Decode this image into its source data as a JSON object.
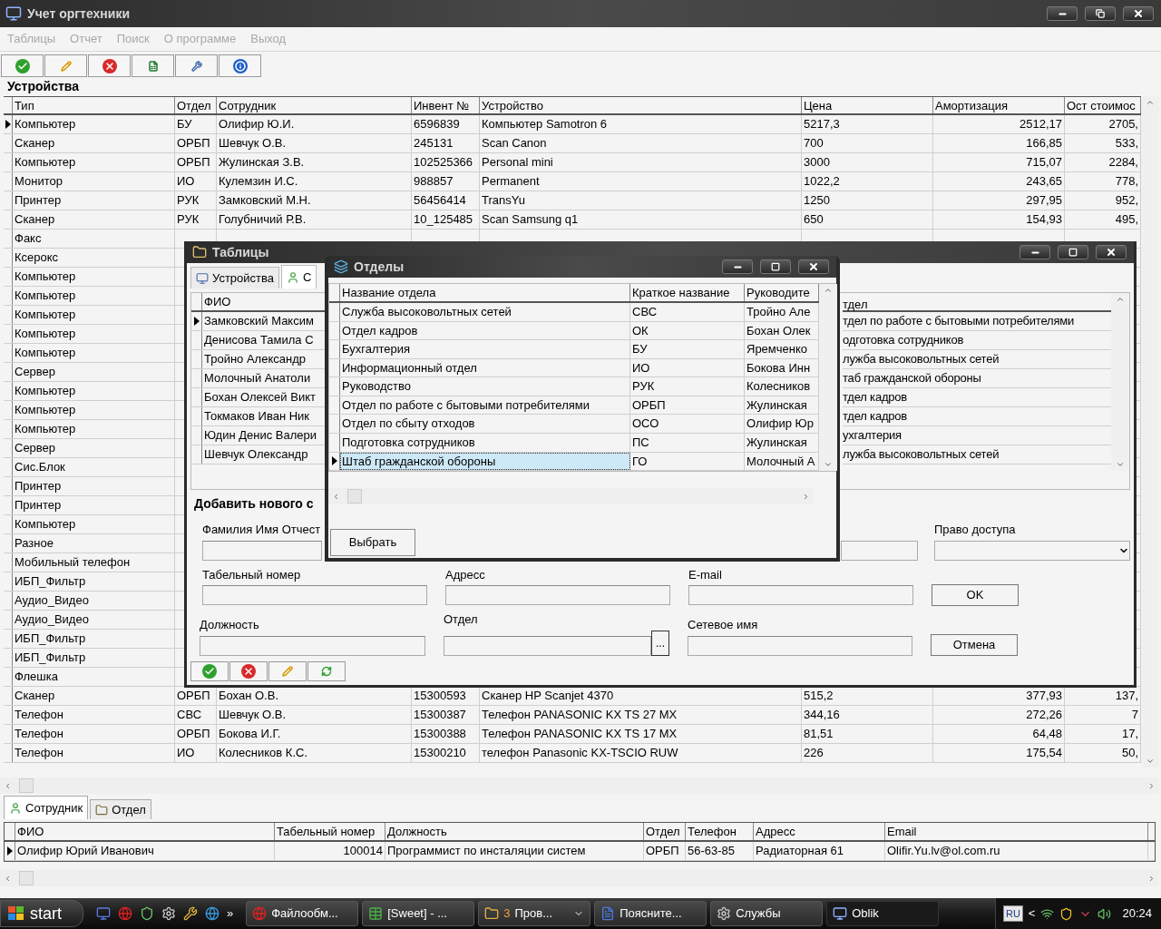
{
  "main_window": {
    "title": "Учет оргтехники",
    "menu": [
      {
        "label": "Таблицы",
        "disabled": true
      },
      {
        "label": "Отчет",
        "disabled": true
      },
      {
        "label": "Поиск",
        "disabled": true
      },
      {
        "label": "О программе",
        "disabled": true
      },
      {
        "label": "Выход",
        "disabled": true
      }
    ],
    "toolbar": [
      {
        "kind": "apply"
      },
      {
        "kind": "edit"
      },
      {
        "kind": "delete"
      },
      {
        "kind": "excel"
      },
      {
        "kind": "tools"
      },
      {
        "kind": "info"
      }
    ],
    "section_title": "Устройства",
    "table": {
      "columns": [
        "Тип",
        "Отдел",
        "Сотрудник",
        "Инвент №",
        "Устройство",
        "Цена",
        "Амортизация",
        "Ост стоимос"
      ],
      "rows": [
        {
          "selected": true,
          "cells": [
            "Компьютер",
            "БУ",
            "Олифир Ю.И.",
            "6596839",
            "Компьютер Samotron 6",
            "5217,3",
            "2512,17",
            "2705,"
          ]
        },
        {
          "selected": false,
          "cells": [
            "Сканер",
            "ОРБП",
            "Шевчук О.В.",
            "245131",
            "Scan Canon",
            "700",
            "166,85",
            "533,"
          ]
        },
        {
          "selected": false,
          "cells": [
            "Компьютер",
            "ОРБП",
            "Жулинская З.В.",
            "102525366",
            "Personal mini",
            "3000",
            "715,07",
            "2284,"
          ]
        },
        {
          "selected": false,
          "cells": [
            "Монитор",
            "ИО",
            "Кулемзин И.С.",
            "988857",
            "Permanent",
            "1022,2",
            "243,65",
            "778,"
          ]
        },
        {
          "selected": false,
          "cells": [
            "Принтер",
            "РУК",
            "Замковский М.Н.",
            "56456414",
            "TransYu",
            "1250",
            "297,95",
            "952,"
          ]
        },
        {
          "selected": false,
          "cells": [
            "Сканер",
            "РУК",
            "Голубничий Р.В.",
            "10_125485",
            "Scan Samsung q1",
            "650",
            "154,93",
            "495,"
          ]
        },
        {
          "selected": false,
          "cells": [
            "Факс"
          ]
        },
        {
          "selected": false,
          "cells": [
            "Ксерокс"
          ]
        },
        {
          "selected": false,
          "cells": [
            "Компьютер"
          ]
        },
        {
          "selected": false,
          "cells": [
            "Компьютер"
          ]
        },
        {
          "selected": false,
          "cells": [
            "Компьютер"
          ]
        },
        {
          "selected": false,
          "cells": [
            "Компьютер"
          ]
        },
        {
          "selected": false,
          "cells": [
            "Компьютер"
          ]
        },
        {
          "selected": false,
          "cells": [
            "Сервер"
          ]
        },
        {
          "selected": false,
          "cells": [
            "Компьютер"
          ]
        },
        {
          "selected": false,
          "cells": [
            "Компьютер"
          ]
        },
        {
          "selected": false,
          "cells": [
            "Компьютер"
          ]
        },
        {
          "selected": false,
          "cells": [
            "Сервер"
          ]
        },
        {
          "selected": false,
          "cells": [
            "Сис.Блок"
          ]
        },
        {
          "selected": false,
          "cells": [
            "Принтер"
          ]
        },
        {
          "selected": false,
          "cells": [
            "Принтер"
          ]
        },
        {
          "selected": false,
          "cells": [
            "Компьютер"
          ]
        },
        {
          "selected": false,
          "cells": [
            "Разное"
          ]
        },
        {
          "selected": false,
          "cells": [
            "Мобильный телефон"
          ]
        },
        {
          "selected": false,
          "cells": [
            "ИБП_Фильтр"
          ]
        },
        {
          "selected": false,
          "cells": [
            "Аудио_Видео"
          ]
        },
        {
          "selected": false,
          "cells": [
            "Аудио_Видео"
          ]
        },
        {
          "selected": false,
          "cells": [
            "ИБП_Фильтр"
          ]
        },
        {
          "selected": false,
          "cells": [
            "ИБП_Фильтр"
          ]
        },
        {
          "selected": false,
          "cells": [
            "Флешка"
          ]
        },
        {
          "selected": false,
          "cells": [
            "Сканер",
            "ОРБП",
            "Бохан О.В.",
            "15300593",
            "Сканер HP Scanjet 4370",
            "515,2",
            "377,93",
            "137,"
          ]
        },
        {
          "selected": false,
          "cells": [
            "Телефон",
            "СВС",
            "Шевчук О.В.",
            "15300387",
            "Телефон PANASONIC KX TS 27 MX",
            "344,16",
            "272,26",
            "7"
          ]
        },
        {
          "selected": false,
          "cells": [
            "Телефон",
            "ОРБП",
            "Бокова И.Г.",
            "15300388",
            "Телефон PANASONIC KX TS 17 MX",
            "81,51",
            "64,48",
            "17,"
          ]
        },
        {
          "selected": false,
          "cells": [
            "Телефон",
            "ИО",
            "Колесников К.С.",
            "15300210",
            "телефон Panasonic KX-TSCIO RUW",
            "226",
            "175,54",
            "50,"
          ]
        }
      ]
    },
    "tabs": [
      {
        "label": "Сотрудник",
        "kind": "person",
        "selected": true
      },
      {
        "label": "Отдел",
        "kind": "department",
        "selected": false
      }
    ],
    "detail_table": {
      "columns": [
        "ФИО",
        "Табельный номер",
        "Должность",
        "Отдел",
        "Телефон",
        "Адресс",
        "Email"
      ],
      "rows": [
        {
          "selected": true,
          "cells": [
            "Олифир Юрий Иванович",
            "100014",
            "Программист по инсталяции систем",
            "ОРБП",
            "56-63-85",
            "Радиаторная 61",
            "Olifir.Yu.lv@ol.com.ru"
          ]
        }
      ]
    }
  },
  "tables_window": {
    "title": "Таблицы",
    "tabs": [
      {
        "label": "Устройства",
        "kind": "devices",
        "selected": false
      },
      {
        "label": "С",
        "kind": "person",
        "selected": true
      }
    ],
    "left_grid": {
      "column": "ФИО",
      "rows": [
        {
          "selected": true,
          "text": "Замковский Максим"
        },
        {
          "selected": false,
          "text": "Денисова Тамила С"
        },
        {
          "selected": false,
          "text": "Тройно Александр"
        },
        {
          "selected": false,
          "text": "Молочный Анатоли"
        },
        {
          "selected": false,
          "text": "Бохан Олексей Викт"
        },
        {
          "selected": false,
          "text": "Токмаков Иван Ник"
        },
        {
          "selected": false,
          "text": "Юдин Денис Валери"
        },
        {
          "selected": false,
          "text": "Шевчук Олександр"
        }
      ]
    },
    "right_grid": {
      "column": "тдел",
      "rows": [
        "тдел по работе с бытовыми потребителями",
        "одготовка сотрудников",
        "лужба высоковольтных сетей",
        "таб гражданской обороны",
        "тдел кадров",
        "тдел кадров",
        "ухгалтерия",
        "лужба высоковольтных сетей"
      ]
    },
    "form_title": "Добавить нового с",
    "fields": [
      {
        "label": "Фамилия Имя Отчест"
      },
      {
        "label": "Право доступа",
        "kind": "dropdown"
      },
      {
        "label": "Табельный номер"
      },
      {
        "label": "Адресс"
      },
      {
        "label": "E-mail"
      },
      {
        "label": "Должность"
      },
      {
        "label": "Отдел",
        "kind": "browse",
        "button": "..."
      },
      {
        "label": "Сетевое имя"
      }
    ],
    "buttons": [
      "OK",
      "Отмена"
    ],
    "toolbar": [
      {
        "kind": "apply"
      },
      {
        "kind": "delete"
      },
      {
        "kind": "edit"
      },
      {
        "kind": "refresh"
      }
    ]
  },
  "departments_window": {
    "title": "Отделы",
    "columns": [
      "Название отдела",
      "Краткое название",
      "Руководите"
    ],
    "rows": [
      {
        "selected": false,
        "cells": [
          "Служба высоковольтных сетей",
          "СВС",
          "Тройно Але"
        ]
      },
      {
        "selected": false,
        "cells": [
          "Отдел кадров",
          "ОК",
          "Бохан Олек"
        ]
      },
      {
        "selected": false,
        "cells": [
          "Бухгалтерия",
          "БУ",
          "Яремченко"
        ]
      },
      {
        "selected": false,
        "cells": [
          "Информационный отдел",
          "ИО",
          "Бокова Инн"
        ]
      },
      {
        "selected": false,
        "cells": [
          "Руководство",
          "РУК",
          "Колесников"
        ]
      },
      {
        "selected": false,
        "cells": [
          "Отдел по работе с бытовыми потребителями",
          "ОРБП",
          "Жулинская"
        ]
      },
      {
        "selected": false,
        "cells": [
          "Отдел по сбыту отходов",
          "ОСО",
          "Олифир Юр"
        ]
      },
      {
        "selected": false,
        "cells": [
          "Подготовка сотрудников",
          "ПС",
          "Жулинская"
        ]
      },
      {
        "selected": true,
        "cells": [
          "Штаб гражданской обороны",
          "ГО",
          "Молочный А"
        ]
      }
    ],
    "button": "Выбрать"
  },
  "taskbar": {
    "start": "start",
    "more": "»",
    "tasks": [
      {
        "label": "Файлообм...",
        "kind": "browser",
        "selected": false
      },
      {
        "label": "[Sweet] - ...",
        "kind": "sheet",
        "selected": false
      },
      {
        "count": "3",
        "label": "Пров...",
        "kind": "group",
        "selected": false
      },
      {
        "label": "Поясните...",
        "kind": "document",
        "selected": false
      },
      {
        "label": "Службы",
        "kind": "services",
        "selected": false
      },
      {
        "label": "Oblik",
        "kind": "app",
        "selected": true
      }
    ],
    "language": "RU",
    "tray_toggle": "<",
    "clock": "20:24"
  }
}
